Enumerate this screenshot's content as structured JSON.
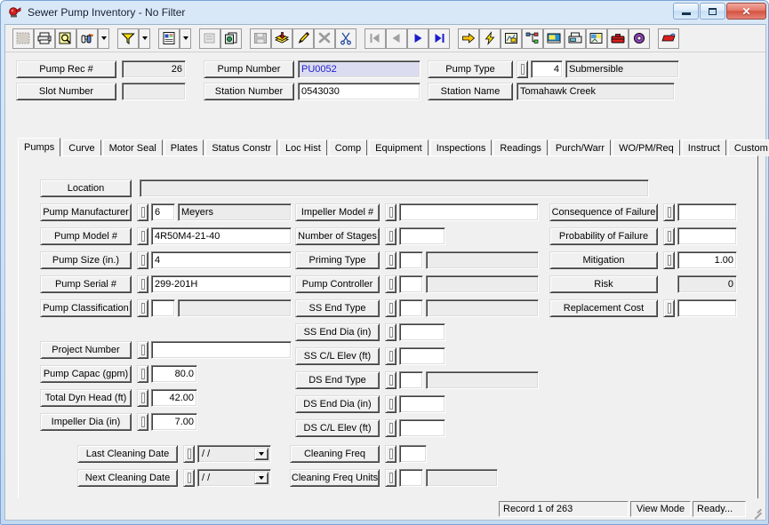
{
  "window": {
    "title": "Sewer Pump Inventory - No Filter",
    "app_icon": "pump-icon",
    "minimize_label": "–",
    "maximize_label": "□",
    "close_label": "✕"
  },
  "toolbar": {
    "items": [
      {
        "name": "datasheet-view-icon",
        "disabled": true,
        "framed": false,
        "dropdown": false
      },
      {
        "name": "print-icon",
        "disabled": false,
        "framed": false,
        "dropdown": false
      },
      {
        "name": "print-preview-icon",
        "disabled": false,
        "framed": false,
        "dropdown": false
      },
      {
        "name": "find-binoculars-icon",
        "disabled": false,
        "framed": false,
        "dropdown": true
      },
      {
        "name": "filter-funnel-icon",
        "disabled": false,
        "framed": false,
        "dropdown": true
      },
      {
        "name": "report-icon",
        "disabled": false,
        "framed": false,
        "dropdown": true
      },
      {
        "name": "form-properties-icon",
        "disabled": true,
        "framed": false,
        "dropdown": false
      },
      {
        "name": "copy-record-icon",
        "disabled": false,
        "framed": false,
        "dropdown": false
      },
      {
        "name": "save-record-icon",
        "disabled": true,
        "framed": false,
        "dropdown": false
      },
      {
        "name": "add-record-icon",
        "disabled": false,
        "framed": false,
        "dropdown": false
      },
      {
        "name": "edit-record-icon",
        "disabled": false,
        "framed": false,
        "dropdown": false
      },
      {
        "name": "delete-record-icon",
        "disabled": true,
        "framed": false,
        "dropdown": false
      },
      {
        "name": "cut-scissors-icon",
        "disabled": false,
        "framed": false,
        "dropdown": false
      },
      {
        "name": "first-record-icon",
        "disabled": true,
        "framed": false,
        "dropdown": false
      },
      {
        "name": "previous-record-icon",
        "disabled": true,
        "framed": false,
        "dropdown": false
      },
      {
        "name": "next-record-icon",
        "disabled": false,
        "framed": false,
        "dropdown": false
      },
      {
        "name": "last-record-icon",
        "disabled": false,
        "framed": false,
        "dropdown": false
      },
      {
        "name": "goto-arrow-icon",
        "disabled": false,
        "framed": false,
        "dropdown": false
      },
      {
        "name": "lightning-icon",
        "disabled": false,
        "framed": false,
        "dropdown": false
      },
      {
        "name": "map-icon",
        "disabled": false,
        "framed": false,
        "dropdown": false
      },
      {
        "name": "hierarchy-icon",
        "disabled": false,
        "framed": false,
        "dropdown": false
      },
      {
        "name": "photo-icon",
        "disabled": false,
        "framed": false,
        "dropdown": false
      },
      {
        "name": "fax-icon",
        "disabled": false,
        "framed": false,
        "dropdown": false
      },
      {
        "name": "attachment-image-icon",
        "disabled": false,
        "framed": false,
        "dropdown": false
      },
      {
        "name": "toolbox-icon",
        "disabled": false,
        "framed": false,
        "dropdown": false
      },
      {
        "name": "help-book-icon",
        "disabled": false,
        "framed": false,
        "dropdown": false
      },
      {
        "name": "exit-icon",
        "disabled": false,
        "framed": false,
        "dropdown": false
      }
    ]
  },
  "header": {
    "pump_rec_label": "Pump Rec #",
    "pump_rec_value": "26",
    "slot_number_label": "Slot Number",
    "slot_number_value": "",
    "pump_number_label": "Pump Number",
    "pump_number_value": "PU0052",
    "station_number_label": "Station Number",
    "station_number_value": "0543030",
    "pump_type_label": "Pump Type",
    "pump_type_code": "4",
    "pump_type_desc": "Submersible",
    "station_name_label": "Station Name",
    "station_name_value": "Tomahawk Creek"
  },
  "tabs": {
    "items": [
      {
        "label": "Pumps",
        "active": true
      },
      {
        "label": "Curve",
        "active": false
      },
      {
        "label": "Motor Seal",
        "active": false
      },
      {
        "label": "Plates",
        "active": false
      },
      {
        "label": "Status Constr",
        "active": false
      },
      {
        "label": "Loc Hist",
        "active": false
      },
      {
        "label": "Comp",
        "active": false
      },
      {
        "label": "Equipment",
        "active": false
      },
      {
        "label": "Inspections",
        "active": false
      },
      {
        "label": "Readings",
        "active": false
      },
      {
        "label": "Purch/Warr",
        "active": false
      },
      {
        "label": "WO/PM/Req",
        "active": false
      },
      {
        "label": "Instruct",
        "active": false
      },
      {
        "label": "Custom",
        "active": false
      }
    ],
    "scroll_left": "◄",
    "scroll_right": "►"
  },
  "form": {
    "location": {
      "label": "Location",
      "value": ""
    },
    "left_group_a": [
      {
        "label": "Pump Manufacturer",
        "code": "6",
        "value": "Meyers"
      },
      {
        "label": "Pump Model #",
        "code": null,
        "value": "4R50M4-21-40"
      },
      {
        "label": "Pump Size (in.)",
        "code": null,
        "value": "4"
      },
      {
        "label": "Pump Serial #",
        "code": null,
        "value": "299-201H"
      },
      {
        "label": "Pump Classification",
        "code": "",
        "value": ""
      }
    ],
    "left_group_b": [
      {
        "label": "Project Number",
        "code": null,
        "value": ""
      },
      {
        "label": "Pump Capac (gpm)",
        "code": null,
        "value": "80.0"
      },
      {
        "label": "Total Dyn Head (ft)",
        "code": null,
        "value": "42.00"
      },
      {
        "label": "Impeller Dia (in)",
        "code": null,
        "value": "7.00"
      }
    ],
    "mid_group": [
      {
        "label": "Impeller Model #",
        "code": null,
        "value": ""
      },
      {
        "label": "Number of Stages",
        "code": null,
        "value": ""
      },
      {
        "label": "Priming Type",
        "code": "",
        "value": ""
      },
      {
        "label": "Pump Controller",
        "code": "",
        "value": ""
      },
      {
        "label": "SS End Type",
        "code": "",
        "value": ""
      },
      {
        "label": "SS End Dia (in)",
        "code": null,
        "value": ""
      },
      {
        "label": "SS C/L Elev (ft)",
        "code": null,
        "value": ""
      },
      {
        "label": "DS End Type",
        "code": "",
        "value": ""
      },
      {
        "label": "DS End Dia (in)",
        "code": null,
        "value": ""
      },
      {
        "label": "DS C/L Elev (ft)",
        "code": null,
        "value": ""
      }
    ],
    "right_group": [
      {
        "label": "Consequence of Failure",
        "value": "",
        "lookup": true,
        "readonly": false
      },
      {
        "label": "Probability of Failure",
        "value": "",
        "lookup": true,
        "readonly": false
      },
      {
        "label": "Mitigation",
        "value": "1.00",
        "lookup": true,
        "readonly": false
      },
      {
        "label": "Risk",
        "value": "0",
        "lookup": false,
        "readonly": true
      },
      {
        "label": "Replacement Cost",
        "value": "",
        "lookup": true,
        "readonly": false
      }
    ],
    "cleaning": {
      "last_cleaning_label": "Last Cleaning Date",
      "last_cleaning_value": "  /  /",
      "next_cleaning_label": "Next Cleaning Date",
      "next_cleaning_value": "  /  /",
      "cleaning_freq_label": "Cleaning Freq",
      "cleaning_freq_value": "",
      "cleaning_freq_units_label": "Cleaning Freq Units",
      "cleaning_freq_units_code": "",
      "cleaning_freq_units_value": ""
    }
  },
  "statusbar": {
    "record": "Record 1 of 263",
    "mode": "View Mode",
    "state": "Ready..."
  }
}
